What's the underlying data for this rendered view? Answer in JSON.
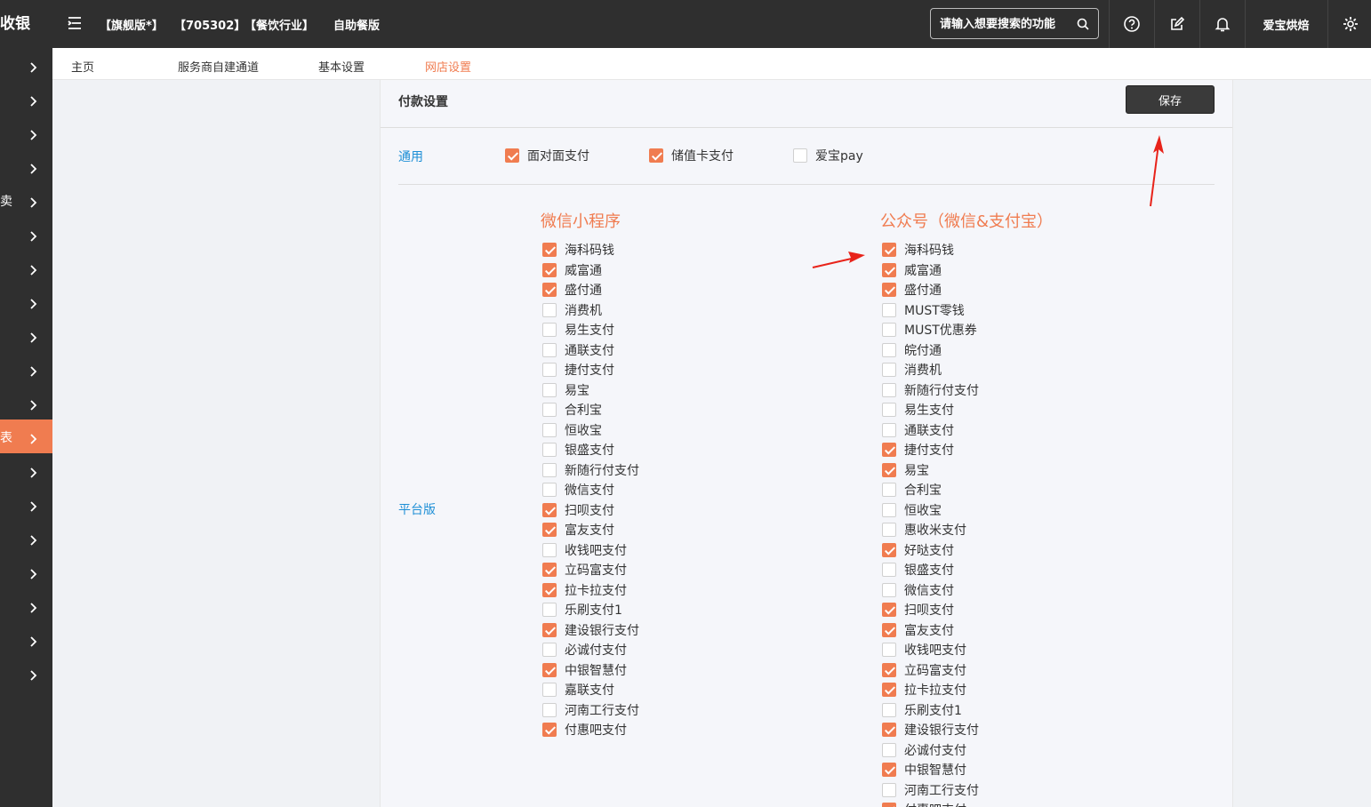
{
  "header": {
    "brand": "收银",
    "tags": [
      "【旗舰版*】",
      "【705302】",
      "【餐饮行业】",
      "自助餐版"
    ],
    "search_placeholder": "请输入想要搜索的功能",
    "user_name": "爱宝烘焙"
  },
  "sidebar": {
    "items": [
      {
        "label": ""
      },
      {
        "label": ""
      },
      {
        "label": ""
      },
      {
        "label": ""
      },
      {
        "label": "卖"
      },
      {
        "label": ""
      },
      {
        "label": ""
      },
      {
        "label": ""
      },
      {
        "label": ""
      },
      {
        "label": ""
      },
      {
        "label": ""
      },
      {
        "label": "表",
        "active": true
      },
      {
        "label": ""
      },
      {
        "label": ""
      },
      {
        "label": ""
      },
      {
        "label": ""
      },
      {
        "label": ""
      },
      {
        "label": ""
      },
      {
        "label": ""
      }
    ]
  },
  "tabs": [
    {
      "label": "主页"
    },
    {
      "label": "服务商自建通道"
    },
    {
      "label": "基本设置"
    },
    {
      "label": "网店设置",
      "active": true
    }
  ],
  "panel": {
    "title": "付款设置",
    "save_label": "保存",
    "general": {
      "label": "通用",
      "options": [
        {
          "label": "面对面支付",
          "checked": true
        },
        {
          "label": "储值卡支付",
          "checked": true
        },
        {
          "label": "爱宝pay",
          "checked": false
        }
      ]
    },
    "platform": {
      "label": "平台版",
      "wechat_mini": {
        "title": "微信小程序",
        "options": [
          {
            "label": "海科码钱",
            "checked": true
          },
          {
            "label": "威富通",
            "checked": true
          },
          {
            "label": "盛付通",
            "checked": true
          },
          {
            "label": "消费机",
            "checked": false
          },
          {
            "label": "易生支付",
            "checked": false
          },
          {
            "label": "通联支付",
            "checked": false
          },
          {
            "label": "捷付支付",
            "checked": false
          },
          {
            "label": "易宝",
            "checked": false
          },
          {
            "label": "合利宝",
            "checked": false
          },
          {
            "label": "恒收宝",
            "checked": false
          },
          {
            "label": "银盛支付",
            "checked": false
          },
          {
            "label": "新随行付支付",
            "checked": false
          },
          {
            "label": "微信支付",
            "checked": false
          },
          {
            "label": "扫呗支付",
            "checked": true
          },
          {
            "label": "富友支付",
            "checked": true
          },
          {
            "label": "收钱吧支付",
            "checked": false
          },
          {
            "label": "立码富支付",
            "checked": true
          },
          {
            "label": "拉卡拉支付",
            "checked": true
          },
          {
            "label": "乐刷支付1",
            "checked": false
          },
          {
            "label": "建设银行支付",
            "checked": true
          },
          {
            "label": "必诚付支付",
            "checked": false
          },
          {
            "label": "中银智慧付",
            "checked": true
          },
          {
            "label": "嘉联支付",
            "checked": false
          },
          {
            "label": "河南工行支付",
            "checked": false
          },
          {
            "label": "付惠吧支付",
            "checked": true
          }
        ]
      },
      "official_account": {
        "title": "公众号（微信&支付宝）",
        "options": [
          {
            "label": "海科码钱",
            "checked": true
          },
          {
            "label": "威富通",
            "checked": true
          },
          {
            "label": "盛付通",
            "checked": true
          },
          {
            "label": "MUST零钱",
            "checked": false
          },
          {
            "label": "MUST优惠券",
            "checked": false
          },
          {
            "label": "皖付通",
            "checked": false
          },
          {
            "label": "消费机",
            "checked": false
          },
          {
            "label": "新随行付支付",
            "checked": false
          },
          {
            "label": "易生支付",
            "checked": false
          },
          {
            "label": "通联支付",
            "checked": false
          },
          {
            "label": "捷付支付",
            "checked": true
          },
          {
            "label": "易宝",
            "checked": true
          },
          {
            "label": "合利宝",
            "checked": false
          },
          {
            "label": "恒收宝",
            "checked": false
          },
          {
            "label": "惠收米支付",
            "checked": false
          },
          {
            "label": "好哒支付",
            "checked": true
          },
          {
            "label": "银盛支付",
            "checked": false
          },
          {
            "label": "微信支付",
            "checked": false
          },
          {
            "label": "扫呗支付",
            "checked": true
          },
          {
            "label": "富友支付",
            "checked": true
          },
          {
            "label": "收钱吧支付",
            "checked": false
          },
          {
            "label": "立码富支付",
            "checked": true
          },
          {
            "label": "拉卡拉支付",
            "checked": true
          },
          {
            "label": "乐刷支付1",
            "checked": false
          },
          {
            "label": "建设银行支付",
            "checked": true
          },
          {
            "label": "必诚付支付",
            "checked": false
          },
          {
            "label": "中银智慧付",
            "checked": true
          },
          {
            "label": "河南工行支付",
            "checked": false
          },
          {
            "label": "付惠吧支付",
            "checked": true
          }
        ]
      }
    }
  },
  "colors": {
    "accent": "#f07c50",
    "link": "#1e8fd6",
    "dark": "#2f2f2f",
    "annotation": "#e8231a"
  }
}
